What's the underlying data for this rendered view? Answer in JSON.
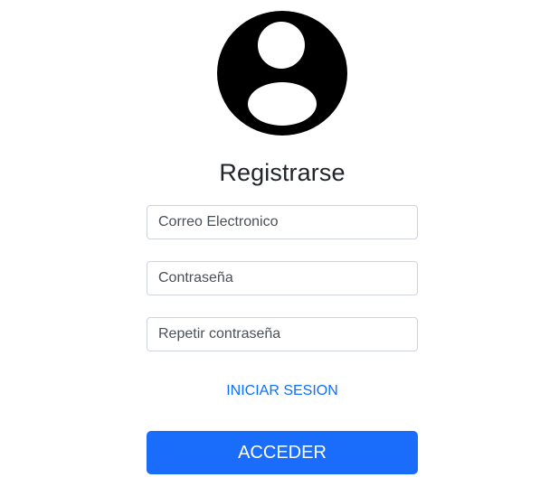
{
  "form": {
    "avatar_icon": "person-circle-icon",
    "title": "Registrarse",
    "email_placeholder": "Correo Electronico",
    "password_placeholder": "Contraseña",
    "repeat_password_placeholder": "Repetir contraseña",
    "login_link": "INICIAR SESION",
    "submit_label": "ACCEDER"
  },
  "colors": {
    "accent": "#1a6dfb",
    "link": "#0d6efd",
    "text": "#212529",
    "border": "#ced4da"
  }
}
